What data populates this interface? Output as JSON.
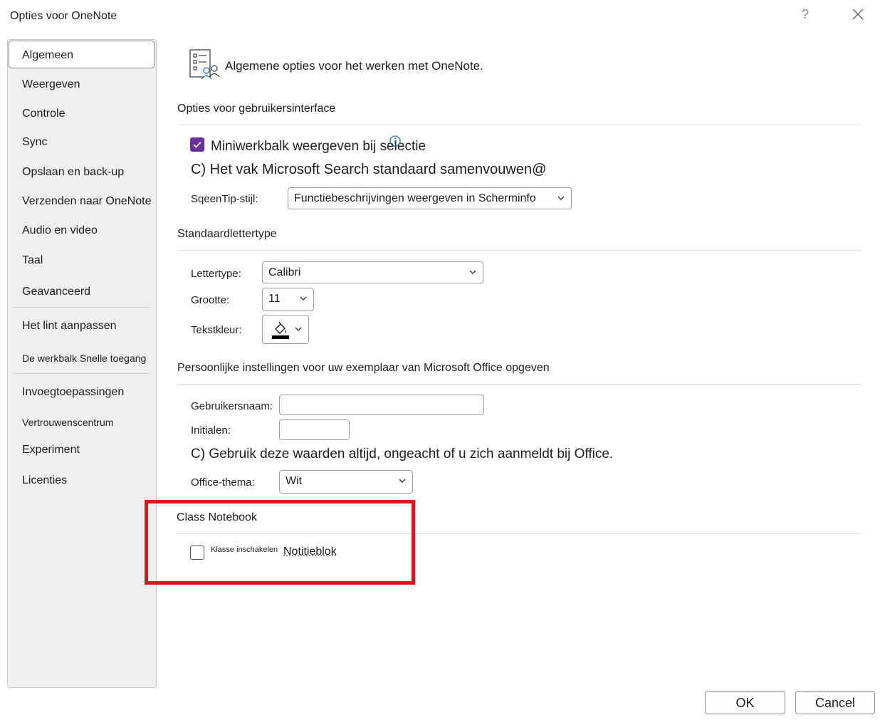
{
  "dialog": {
    "title": "Opties voor OneNote",
    "help": "?"
  },
  "sidebar": {
    "items": [
      {
        "label": "Algemeen"
      },
      {
        "label": "Weergeven"
      },
      {
        "label": "Controle"
      },
      {
        "label": "Sync"
      },
      {
        "label": "Opslaan en back-up"
      },
      {
        "label": "Verzenden naar OneNote"
      },
      {
        "label": "Audio en video"
      },
      {
        "label": "Taal"
      },
      {
        "label": "Geavanceerd"
      },
      {
        "label": "Het lint aanpassen"
      },
      {
        "label": "De werkbalk Snelle toegang"
      },
      {
        "label": "Invoegtoepassingen"
      },
      {
        "label": "Vertrouwenscentrum"
      },
      {
        "label": "Experiment"
      },
      {
        "label": "Licenties"
      }
    ],
    "selected": "Algemeen"
  },
  "main": {
    "header": "Algemene opties voor het werken met OneNote.",
    "ui_options": {
      "title": "Opties voor gebruikersinterface",
      "mini_toolbar_label": "Miniwerkbalk weergeven bij selectie",
      "mini_toolbar_checked": true,
      "search_collapse_text": "C) Het vak Microsoft Search standaard samenvouwen@",
      "screentip_label": "SqeenTip-stijl:",
      "screentip_value": "Functiebeschrijvingen weergeven in Scherminfo"
    },
    "default_font": {
      "title": "Standaardlettertype",
      "font_label": "Lettertype:",
      "font_value": "Calibri",
      "size_label": "Grootte:",
      "size_value": "11",
      "color_label": "Tekstkleur:",
      "color_value": "#000000"
    },
    "personal": {
      "title": "Persoonlijke instellingen voor uw exemplaar van Microsoft Office opgeven",
      "username_label": "Gebruikersnaam:",
      "username_value": "",
      "initials_label": "Initialen:",
      "initials_value": "",
      "always_use_text": "C) Gebruik deze waarden altijd, ongeacht of u zich aanmeldt bij Office.",
      "theme_label": "Office-thema:",
      "theme_value": "Wit"
    },
    "class_notebook": {
      "title": "Class Notebook",
      "enable_small": "Klasse inschakelen",
      "enable_large": "Notitieblok",
      "enabled": false
    }
  },
  "footer": {
    "ok": "OK",
    "cancel": "Cancel"
  },
  "colors": {
    "checkbox_accent": "#6b2fa0",
    "highlight": "#e0161f",
    "info_icon": "#1e73be"
  }
}
